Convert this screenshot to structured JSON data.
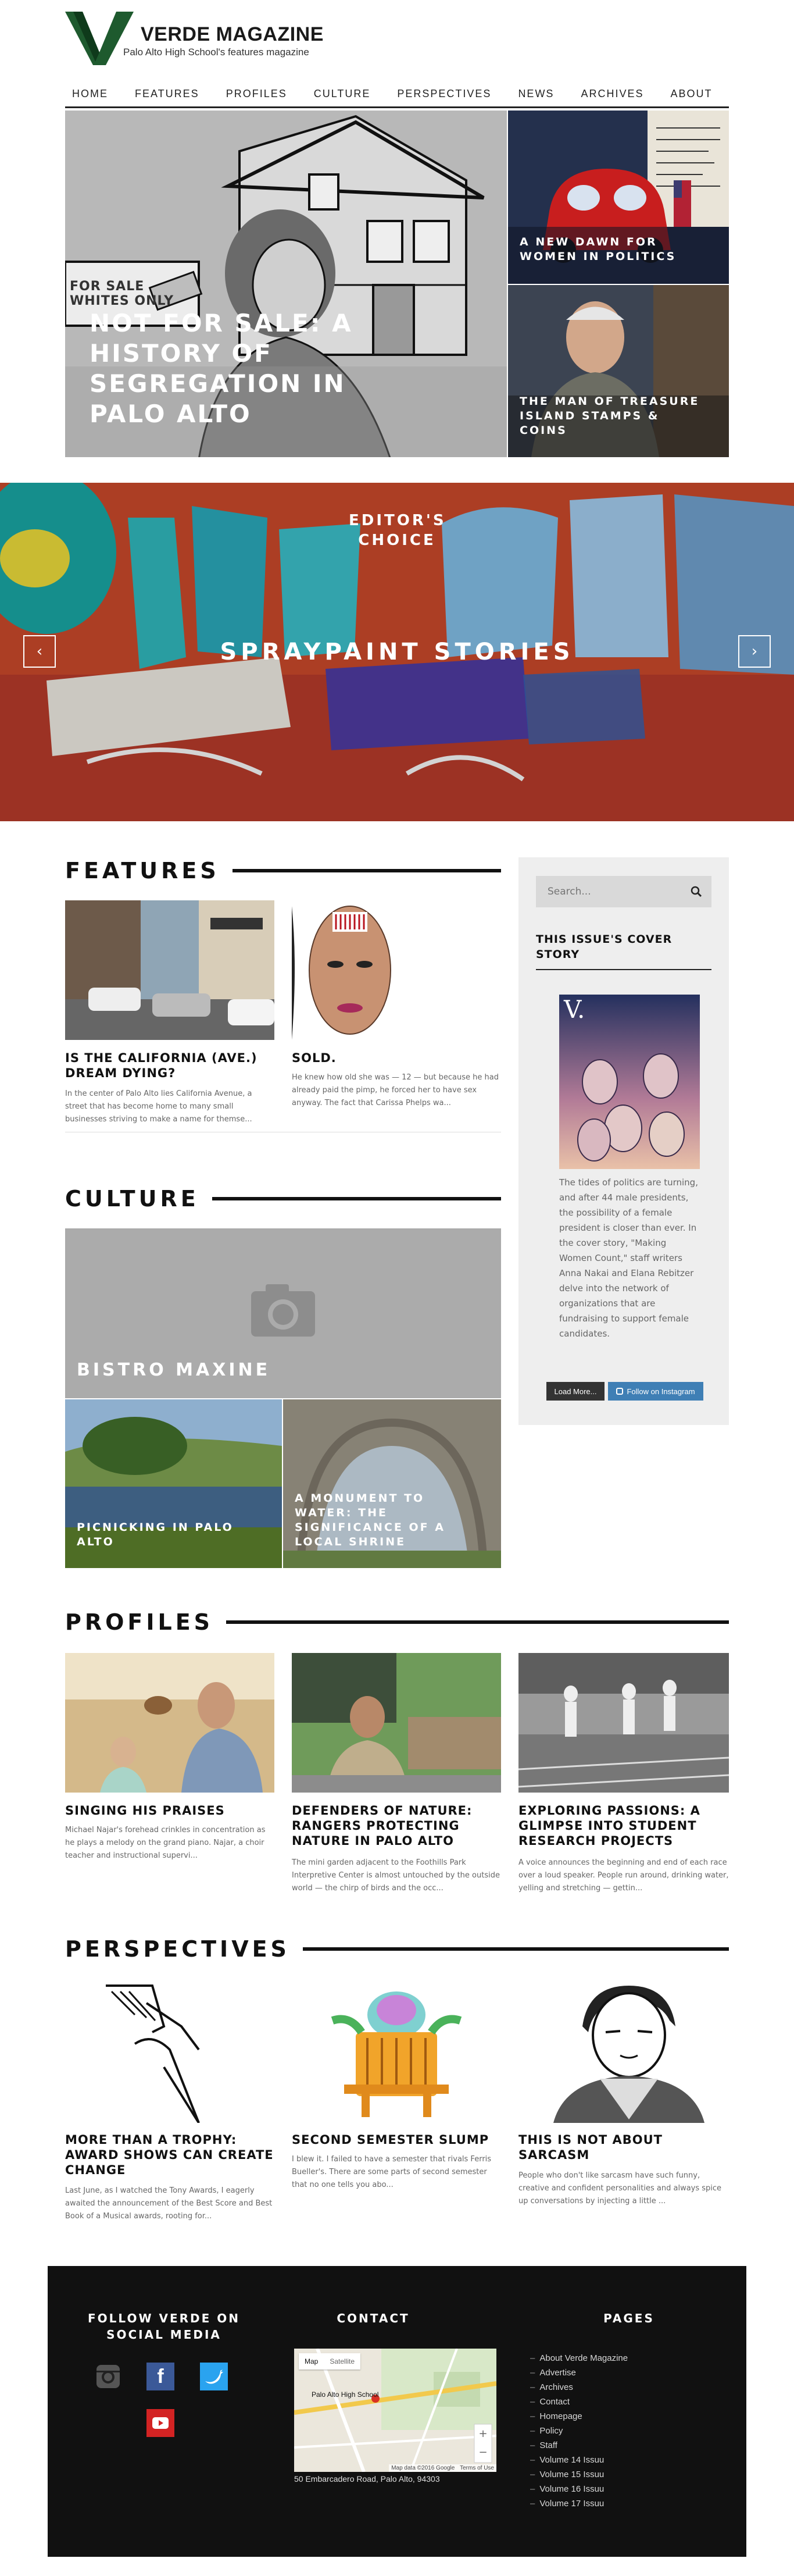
{
  "site": {
    "title": "VERDE MAGAZINE",
    "subtitle": "Palo Alto High School's features magazine",
    "logo_letter": "V"
  },
  "nav": [
    "HOME",
    "FEATURES",
    "PROFILES",
    "CULTURE",
    "PERSPECTIVES",
    "NEWS",
    "ARCHIVES",
    "ABOUT"
  ],
  "hero": {
    "main_title": "NOT FOR SALE: A HISTORY OF SEGREGATION IN PALO ALTO",
    "main_sign_text": "FOR SALE WHITES ONLY",
    "side1_title": "A NEW DAWN FOR WOMEN IN POLITICS",
    "side2_title": "THE MAN OF TREASURE ISLAND STAMPS & COINS"
  },
  "slider": {
    "label": "EDITOR'S CHOICE",
    "title": "SPRAYPAINT STORIES",
    "prev": "‹",
    "next": "›"
  },
  "features": {
    "heading": "FEATURES",
    "cards": [
      {
        "title": "IS THE CALIFORNIA (AVE.) DREAM DYING?",
        "excerpt": "In the center of Palo Alto lies California Avenue, a street that has become home to many small businesses striving to make a name for themse..."
      },
      {
        "title": "SOLD.",
        "excerpt": "He knew how old she was — 12 — but because he had already paid the pimp, he forced her to have sex anyway. The fact that Carissa Phelps wa..."
      }
    ]
  },
  "sidebar": {
    "search_placeholder": "Search...",
    "cover_heading": "THIS ISSUE'S COVER STORY",
    "cover_text": "The tides of politics are turning, and after 44 male presidents, the possibility of a female president is closer than ever. In the cover story, \"Making Women Count,\" staff writers Anna Nakai and Elana Rebitzer delve into the network of organizations that are fundraising to support female candidates.",
    "load_more": "Load More...",
    "follow_instagram": "Follow on Instagram"
  },
  "culture": {
    "heading": "CULTURE",
    "big_title": "BISTRO MAXINE",
    "small1": "PICNICKING IN PALO ALTO",
    "small2": "A MONUMENT TO WATER: THE SIGNIFICANCE OF A LOCAL SHRINE"
  },
  "profiles": {
    "heading": "PROFILES",
    "cards": [
      {
        "title": "SINGING HIS PRAISES",
        "excerpt": "Michael Najar's forehead crinkles in concentration as he plays a melody on the grand piano. Najar, a choir teacher and instructional supervi..."
      },
      {
        "title": "DEFENDERS OF NATURE: RANGERS PROTECTING NATURE IN PALO ALTO",
        "excerpt": "The mini garden adjacent to the Foothills Park Interpretive Center is almost untouched by the outside world — the chirp of birds and the occ..."
      },
      {
        "title": "EXPLORING PASSIONS: A GLIMPSE INTO STUDENT RESEARCH PROJECTS",
        "excerpt": "A voice announces the beginning and end of each race over a loud speaker. People run around, drinking water, yelling and stretching — gettin..."
      }
    ]
  },
  "perspectives": {
    "heading": "PERSPECTIVES",
    "cards": [
      {
        "title": "MORE THAN A TROPHY: AWARD SHOWS CAN CREATE CHANGE",
        "excerpt": "Last June, as I watched the Tony Awards, I eagerly awaited the announcement of the Best Score and Best Book of a Musical awards, rooting for..."
      },
      {
        "title": "SECOND SEMESTER SLUMP",
        "excerpt": "I blew it. I failed to have a semester that rivals Ferris Bueller's. There are some parts of second semester that no one tells you abo..."
      },
      {
        "title": "THIS IS NOT ABOUT SARCASM",
        "excerpt": "People who don't like sarcasm have such funny, creative and confident personalities and always spice up conversations by injecting a little ..."
      }
    ]
  },
  "footer": {
    "social_heading": "FOLLOW VERDE ON SOCIAL MEDIA",
    "contact_heading": "CONTACT",
    "pages_heading": "PAGES",
    "map_tabs": [
      "Map",
      "Satellite"
    ],
    "map_place": "Palo Alto High School",
    "map_credit": "Map data ©2016 Google",
    "map_terms": "Terms of Use",
    "address": "50 Embarcadero Road, Palo Alto, 94303",
    "pages": [
      "About Verde Magazine",
      "Advertise",
      "Archives",
      "Contact",
      "Homepage",
      "Policy",
      "Staff",
      "Volume 14 Issuu",
      "Volume 15 Issuu",
      "Volume 16 Issuu",
      "Volume 17 Issuu"
    ]
  },
  "colors": {
    "brand_green": "#1e5a2e",
    "dark": "#111111",
    "sidebar_bg": "#eeeeee",
    "facebook": "#3b5998",
    "twitter": "#2aa3ef",
    "youtube": "#d32323"
  }
}
